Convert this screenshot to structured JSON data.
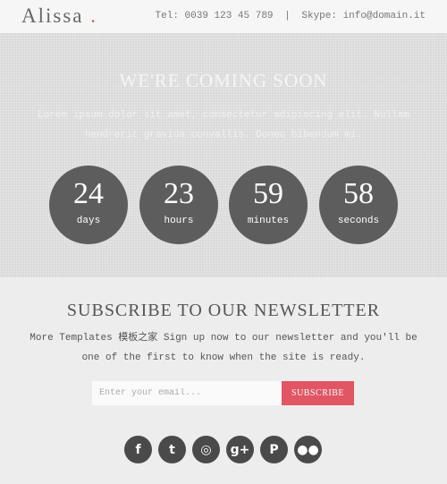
{
  "header": {
    "brand": "Alissa",
    "brand_dot": ".",
    "phone": "Tel: 0039 123 45 789",
    "separator": "|",
    "skype": "Skype: info@domain.it"
  },
  "hero": {
    "title": "WE'RE COMING SOON",
    "text": "Lorem ipsum dolor sit amet, consectetur adipiscing elit. Nullam hendrerit gravida convallis. Donec bibendum mi."
  },
  "countdown": [
    {
      "value": "24",
      "unit": "days"
    },
    {
      "value": "23",
      "unit": "hours"
    },
    {
      "value": "59",
      "unit": "minutes"
    },
    {
      "value": "58",
      "unit": "seconds"
    }
  ],
  "newsletter": {
    "title": "SUBSCRIBE TO OUR NEWSLETTER",
    "text": "More Templates 模板之家 Sign up now to our newsletter and you'll be one of the first to know when the site is ready.",
    "placeholder": "Enter your email...",
    "button": "SUBSCRIBE"
  },
  "socials": [
    {
      "icon": "facebook-icon",
      "glyph": "f"
    },
    {
      "icon": "twitter-icon",
      "glyph": "t"
    },
    {
      "icon": "dribbble-icon",
      "glyph": "◎"
    },
    {
      "icon": "google-plus-icon",
      "glyph": "g+"
    },
    {
      "icon": "pinterest-icon",
      "glyph": "P"
    },
    {
      "icon": "flickr-icon",
      "glyph": "●●"
    }
  ],
  "colors": {
    "accent": "#e25563",
    "circle": "#5d5d5d",
    "social": "#4a4a4a"
  }
}
